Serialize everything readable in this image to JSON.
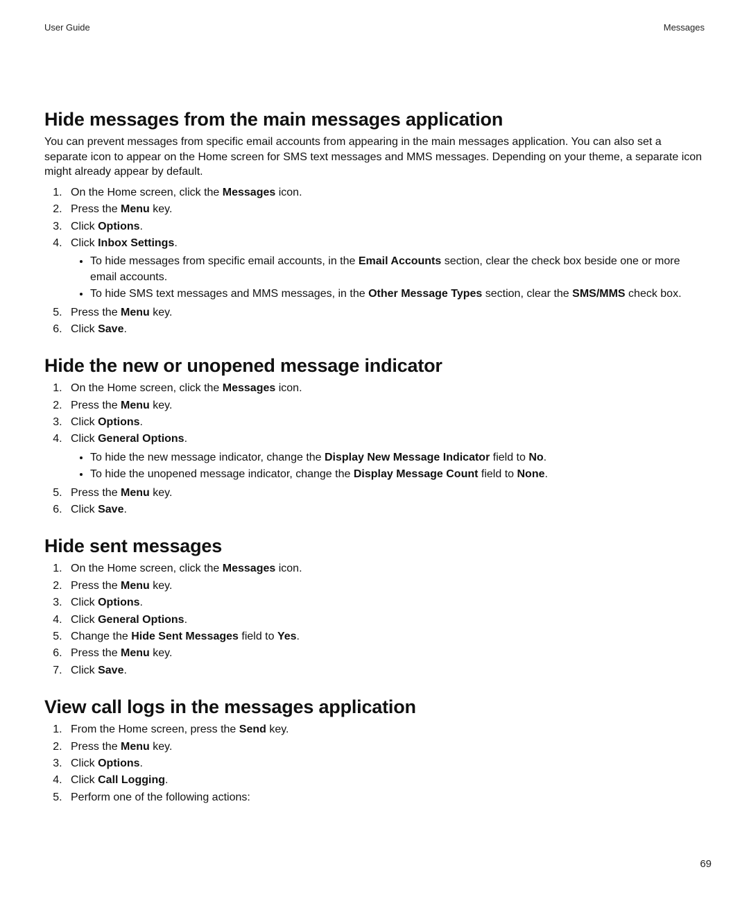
{
  "header": {
    "left": "User Guide",
    "right": "Messages"
  },
  "page_number": "69",
  "sec1": {
    "title": "Hide messages from the main messages application",
    "intro": "You can prevent messages from specific email accounts from appearing in the main messages application. You can also set a separate icon to appear on the Home screen for SMS text messages and MMS messages. Depending on your theme, a separate icon might already appear by default.",
    "s1a": "On the Home screen, click the ",
    "s1b": "Messages",
    "s1c": " icon.",
    "s2a": "Press the ",
    "s2b": "Menu",
    "s2c": " key.",
    "s3a": "Click ",
    "s3b": "Options",
    "s3c": ".",
    "s4a": "Click ",
    "s4b": "Inbox Settings",
    "s4c": ".",
    "b1a": "To hide messages from specific email accounts, in the ",
    "b1b": "Email Accounts",
    "b1c": " section, clear the check box beside one or more email accounts.",
    "b2a": "To hide SMS text messages and MMS messages, in the ",
    "b2b": "Other Message Types",
    "b2c": " section, clear the ",
    "b2d": "SMS/MMS",
    "b2e": " check box.",
    "s5a": "Press the ",
    "s5b": "Menu",
    "s5c": " key.",
    "s6a": "Click ",
    "s6b": "Save",
    "s6c": "."
  },
  "sec2": {
    "title": "Hide the new or unopened message indicator",
    "s1a": "On the Home screen, click the ",
    "s1b": "Messages",
    "s1c": " icon.",
    "s2a": "Press the ",
    "s2b": "Menu",
    "s2c": " key.",
    "s3a": "Click ",
    "s3b": "Options",
    "s3c": ".",
    "s4a": "Click ",
    "s4b": "General Options",
    "s4c": ".",
    "b1a": "To hide the new message indicator, change the ",
    "b1b": "Display New Message Indicator",
    "b1c": " field to ",
    "b1d": "No",
    "b1e": ".",
    "b2a": "To hide the unopened message indicator, change the ",
    "b2b": "Display Message Count",
    "b2c": " field to ",
    "b2d": "None",
    "b2e": ".",
    "s5a": "Press the ",
    "s5b": "Menu",
    "s5c": " key.",
    "s6a": "Click ",
    "s6b": "Save",
    "s6c": "."
  },
  "sec3": {
    "title": "Hide sent messages",
    "s1a": "On the Home screen, click the ",
    "s1b": "Messages",
    "s1c": " icon.",
    "s2a": "Press the ",
    "s2b": "Menu",
    "s2c": " key.",
    "s3a": "Click ",
    "s3b": "Options",
    "s3c": ".",
    "s4a": "Click ",
    "s4b": "General Options",
    "s4c": ".",
    "s5a": "Change the ",
    "s5b": "Hide Sent Messages",
    "s5c": " field to ",
    "s5d": "Yes",
    "s5e": ".",
    "s6a": "Press the ",
    "s6b": "Menu",
    "s6c": " key.",
    "s7a": "Click ",
    "s7b": "Save",
    "s7c": "."
  },
  "sec4": {
    "title": "View call logs in the messages application",
    "s1a": "From the Home screen, press the ",
    "s1b": "Send",
    "s1c": " key.",
    "s2a": "Press the ",
    "s2b": "Menu",
    "s2c": " key.",
    "s3a": "Click ",
    "s3b": "Options",
    "s3c": ".",
    "s4a": "Click ",
    "s4b": "Call Logging",
    "s4c": ".",
    "s5": "Perform one of the following actions:"
  }
}
